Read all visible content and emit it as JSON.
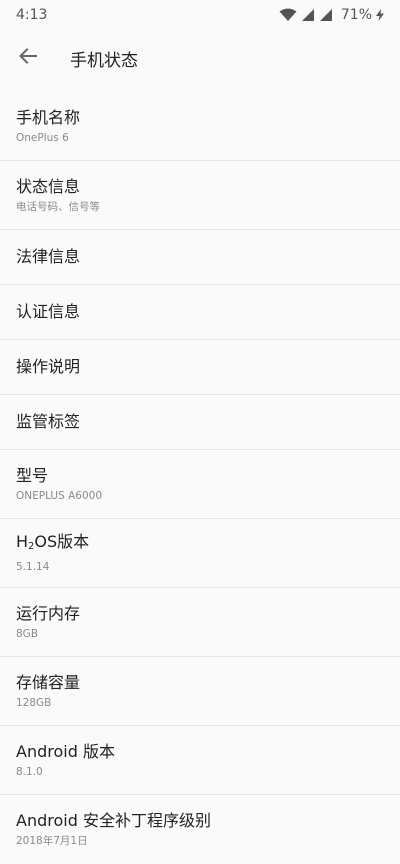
{
  "status_bar": {
    "time": "4:13",
    "battery_text": "71%",
    "icons": [
      "wifi-icon",
      "signal-icon",
      "signal-icon",
      "battery-charging-icon"
    ]
  },
  "app_bar": {
    "back_icon": "arrow-left-icon",
    "title": "手机状态"
  },
  "items": [
    {
      "title": "手机名称",
      "subtitle": "OnePlus 6"
    },
    {
      "title": "状态信息",
      "subtitle": "电话号码、信号等"
    },
    {
      "title": "法律信息"
    },
    {
      "title": "认证信息"
    },
    {
      "title": "操作说明"
    },
    {
      "title": "监管标签"
    },
    {
      "title": "型号",
      "subtitle": "ONEPLUS A6000"
    },
    {
      "title_prefix": "H",
      "title_sub": "2",
      "title_suffix": "OS版本",
      "subtitle": "5.1.14"
    },
    {
      "title": "运行内存",
      "subtitle": "8GB"
    },
    {
      "title": "存储容量",
      "subtitle": "128GB"
    },
    {
      "title": "Android 版本",
      "subtitle": "8.1.0"
    },
    {
      "title": "Android 安全补丁程序级别",
      "subtitle": "2018年7月1日"
    }
  ]
}
